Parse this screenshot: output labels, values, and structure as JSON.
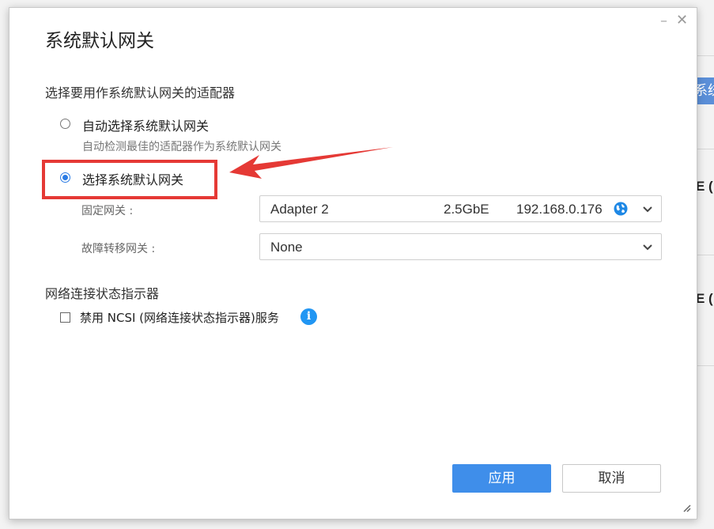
{
  "background": {
    "button_fragment": "系统",
    "row_fragment_1": "E (",
    "row_fragment_2": "E ("
  },
  "dialog": {
    "title": "系统默认网关",
    "minimize_glyph": "–",
    "close_glyph": "✕",
    "adapter_section_title": "选择要用作系统默认网关的适配器",
    "options": [
      {
        "label": "自动选择系统默认网关",
        "description": "自动检测最佳的适配器作为系统默认网关",
        "selected": false
      },
      {
        "label": "选择系统默认网关",
        "selected": true
      }
    ],
    "fixed_gateway": {
      "label": "固定网关 :",
      "adapter": "Adapter 2",
      "speed": "2.5GbE",
      "ip": "192.168.0.176"
    },
    "failover_gateway": {
      "label": "故障转移网关 :",
      "value": "None"
    },
    "ncsi_section_title": "网络连接状态指示器",
    "ncsi_checkbox": {
      "label": "禁用 NCSI (网络连接状态指示器)服务",
      "checked": false
    },
    "apply_label": "应用",
    "cancel_label": "取消"
  },
  "annotation": {
    "highlight_color": "#e53935"
  },
  "colors": {
    "primary": "#3f8eea",
    "radio_accent": "#2a7be4",
    "info": "#2196f3"
  }
}
